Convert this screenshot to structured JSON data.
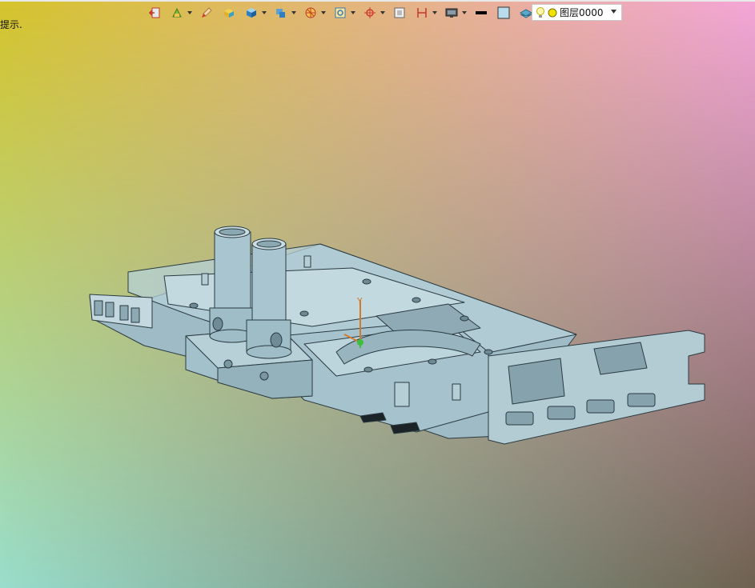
{
  "viewport": {
    "hint_text": "提示.",
    "background": {
      "top_left": "#d6c42c",
      "top_right": "#f4a6d7",
      "bottom_left": "#98ddcc",
      "bottom_right": "#6e6150"
    }
  },
  "toolbar": {
    "buttons": [
      {
        "icon": "exit-sketch-icon"
      },
      {
        "icon": "sketch-layers-icon",
        "dropdown": true
      },
      {
        "icon": "brush-icon"
      },
      {
        "icon": "solid-block-icon"
      },
      {
        "icon": "cube-view-icon",
        "dropdown": true
      },
      {
        "icon": "view-orientation-icon",
        "dropdown": true
      },
      {
        "icon": "section-view-icon",
        "dropdown": true
      },
      {
        "icon": "zoom-fit-icon",
        "dropdown": true
      },
      {
        "icon": "snap-target-icon",
        "dropdown": true
      },
      {
        "icon": "frame-icon"
      },
      {
        "icon": "dimension-icon",
        "dropdown": true
      },
      {
        "icon": "display-monitor-icon",
        "dropdown": true
      },
      {
        "icon": "line-color-icon"
      },
      {
        "icon": "fill-color-icon"
      },
      {
        "icon": "layer-stack-icon",
        "dropdown": true
      }
    ],
    "layer_selector": {
      "value": "图层0000",
      "icons": [
        "light-bulb-icon",
        "layer-color-dot-icon"
      ]
    }
  },
  "model": {
    "name": "graphics-card-water-block",
    "body_color": "#a9c6d0",
    "edge_color": "#2a3a40"
  }
}
